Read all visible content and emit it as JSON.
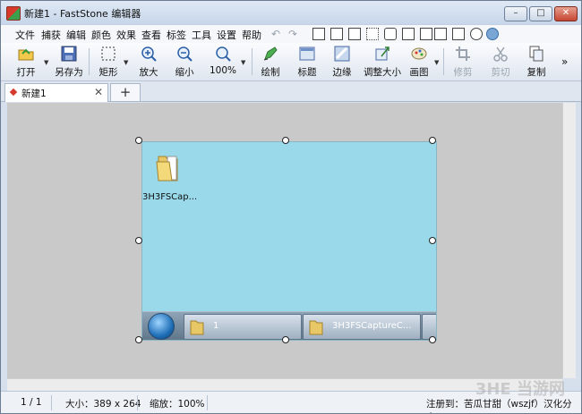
{
  "window": {
    "title": "新建1 - FastStone 编辑器",
    "min": "–",
    "max": "□",
    "close": "✕"
  },
  "menu": [
    "文件",
    "捕获",
    "编辑",
    "颜色",
    "效果",
    "查看",
    "标签",
    "工具",
    "设置",
    "帮助"
  ],
  "toolbar": {
    "open": "打开",
    "save_as": "另存为",
    "rectangle": "矩形",
    "zoom_in": "放大",
    "zoom_out": "缩小",
    "zoom_level": "100%",
    "draw": "绘制",
    "title": "标题",
    "edge": "边缘",
    "resize": "调整大小",
    "canvas": "画图",
    "crop": "修剪",
    "cut": "剪切",
    "copy": "复制",
    "more": "»"
  },
  "tabs": [
    {
      "label": "新建1",
      "close": "✕"
    }
  ],
  "tab_add": "+",
  "image": {
    "desktop_icon_label": "3H3FSCap...",
    "taskbar": [
      {
        "label": "1"
      },
      {
        "label": "3H3FSCaptureC..."
      }
    ]
  },
  "status": {
    "page": "1 / 1",
    "size": "大小：389 x 264",
    "zoom": "缩放：100%",
    "reg": "注册到：苦瓜甘甜（wszjf）汉化分享"
  },
  "watermark": "3HE 当游网"
}
